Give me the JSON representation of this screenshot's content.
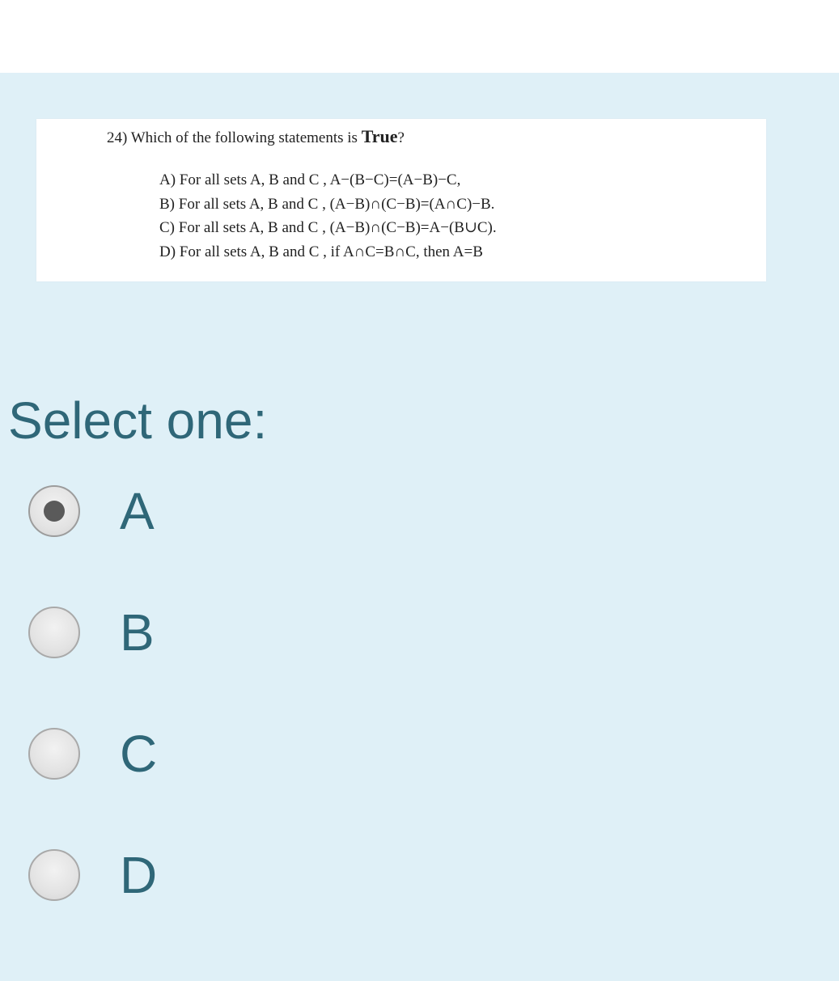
{
  "question": {
    "number": "24)",
    "prompt_before": "Which of the following statements is ",
    "prompt_emphasis": "True",
    "prompt_after": "?",
    "options": [
      "A) For all sets  A, B  and  C ,  A−(B−C)=(A−B)−C,",
      "B)  For all sets  A, B  and  C ,  (A−B)∩(C−B)=(A∩C)−B.",
      "C)  For all sets  A, B  and  C ,  (A−B)∩(C−B)=A−(B∪C).",
      "D)  For all sets  A, B  and  C , if  A∩C=B∩C, then  A=B"
    ]
  },
  "select_heading": "Select one:",
  "answers": [
    {
      "label": "A",
      "selected": true
    },
    {
      "label": "B",
      "selected": false
    },
    {
      "label": "C",
      "selected": false
    },
    {
      "label": "D",
      "selected": false
    }
  ],
  "colors": {
    "panel_bg": "#dff0f7",
    "accent_text": "#2f6778"
  }
}
